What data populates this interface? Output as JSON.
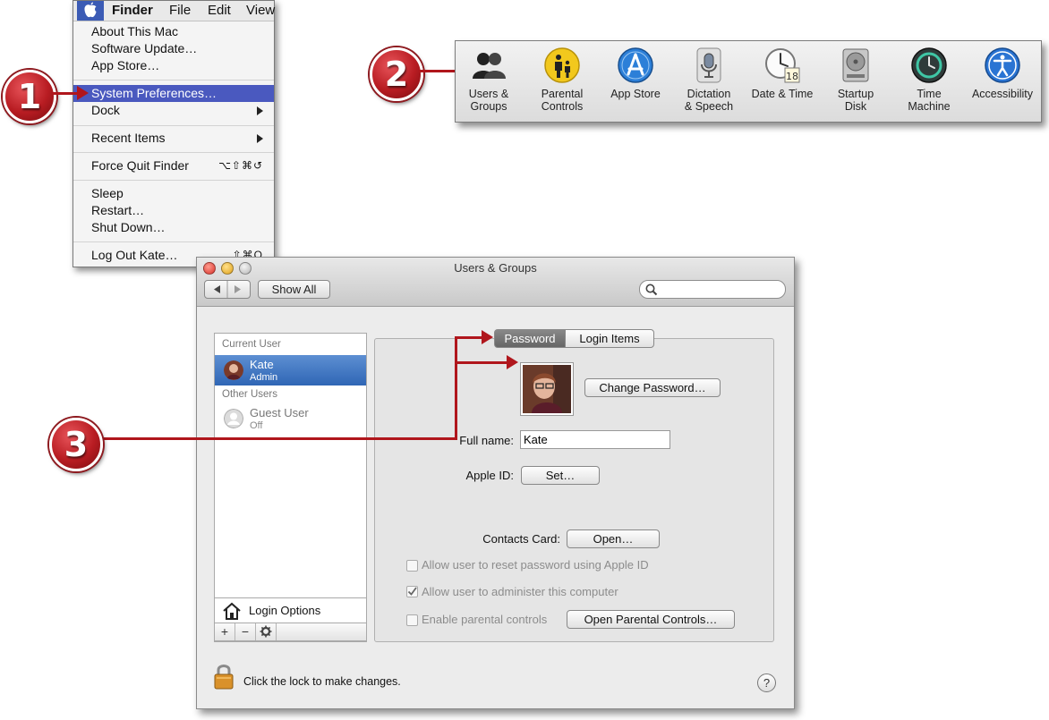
{
  "apple_menu": {
    "menubar": {
      "finder": "Finder",
      "file": "File",
      "edit": "Edit",
      "view": "View"
    },
    "items": {
      "about": "About This Mac",
      "software_update": "Software Update…",
      "app_store": "App Store…",
      "system_preferences": "System Preferences…",
      "dock": "Dock",
      "recent_items": "Recent Items",
      "force_quit": "Force Quit Finder",
      "force_quit_shortcut": "⌥⇧⌘↺",
      "sleep": "Sleep",
      "restart": "Restart…",
      "shut_down": "Shut Down…",
      "log_out": "Log Out Kate…",
      "log_out_shortcut": "⇧⌘Q"
    }
  },
  "badges": {
    "step1": "1",
    "step2": "2",
    "step3": "3"
  },
  "prefs_strip": {
    "items": [
      {
        "label": "Users &\nGroups",
        "icon": "users-groups-icon"
      },
      {
        "label": "Parental\nControls",
        "icon": "parental-controls-icon"
      },
      {
        "label": "App Store",
        "icon": "app-store-icon"
      },
      {
        "label": "Dictation\n& Speech",
        "icon": "microphone-icon"
      },
      {
        "label": "Date & Time",
        "icon": "clock-calendar-icon",
        "calendar_day": "18"
      },
      {
        "label": "Startup\nDisk",
        "icon": "hard-disk-icon"
      },
      {
        "label": "Time\nMachine",
        "icon": "time-machine-icon"
      },
      {
        "label": "Accessibility",
        "icon": "accessibility-icon"
      }
    ]
  },
  "window": {
    "title": "Users & Groups",
    "toolbar": {
      "show_all": "Show All"
    },
    "sidebar": {
      "current_user_header": "Current User",
      "current_user": {
        "name": "Kate",
        "role": "Admin"
      },
      "other_users_header": "Other Users",
      "other_user": {
        "name": "Guest User",
        "status": "Off"
      },
      "login_options": "Login Options",
      "add": "+",
      "remove": "−"
    },
    "tabs": {
      "password": "Password",
      "login_items": "Login Items"
    },
    "detail": {
      "change_password": "Change Password…",
      "full_name_label": "Full name:",
      "full_name_value": "Kate",
      "apple_id_label": "Apple ID:",
      "apple_id_button": "Set…",
      "contacts_card_label": "Contacts Card:",
      "contacts_card_button": "Open…",
      "allow_reset": "Allow user to reset password using Apple ID",
      "allow_admin": "Allow user to administer this computer",
      "enable_parental": "Enable parental controls",
      "open_parental": "Open Parental Controls…"
    },
    "lock_text": "Click the lock to make changes.",
    "help": "?"
  },
  "colors": {
    "menu_highlight": "#4a59bf",
    "selection": "#3b71c1",
    "annotation_red": "#b0161c"
  }
}
